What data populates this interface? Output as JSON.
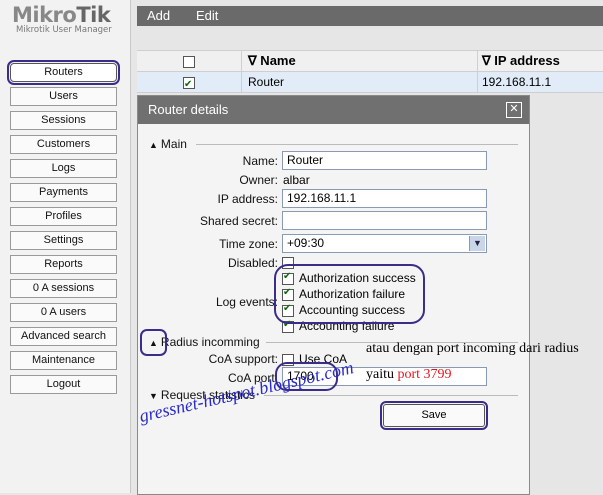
{
  "brand": {
    "logo_main": "Mikro",
    "logo_accent": "Tik",
    "subtitle": "Mikrotik User Manager"
  },
  "sidebar": {
    "items": [
      {
        "label": "Routers",
        "active": true
      },
      {
        "label": "Users"
      },
      {
        "label": "Sessions"
      },
      {
        "label": "Customers"
      },
      {
        "label": "Logs"
      },
      {
        "label": "Payments"
      },
      {
        "label": "Profiles"
      },
      {
        "label": "Settings"
      },
      {
        "label": "Reports"
      },
      {
        "label": "0 A sessions"
      },
      {
        "label": "0 A users"
      },
      {
        "label": "Advanced search"
      },
      {
        "label": "Maintenance"
      },
      {
        "label": "Logout"
      }
    ]
  },
  "toolbar": {
    "add_label": "Add",
    "edit_label": "Edit"
  },
  "table": {
    "headers": {
      "name": "∇ Name",
      "ip": "∇ IP address"
    },
    "rows": [
      {
        "checked": true,
        "name": "Router",
        "ip": "192.168.11.1"
      }
    ]
  },
  "dialog": {
    "title": "Router details",
    "close_symbol": "✕",
    "main_section": "Main",
    "fields": {
      "name_label": "Name:",
      "name_value": "Router",
      "owner_label": "Owner:",
      "owner_value": "albar",
      "ip_label": "IP address:",
      "ip_value": "192.168.11.1",
      "secret_label": "Shared secret:",
      "secret_value": "",
      "timezone_label": "Time zone:",
      "timezone_value": "+09:30",
      "disabled_label": "Disabled:",
      "log_events_label": "Log events:"
    },
    "log_events": [
      {
        "label": "Authorization success",
        "checked": true
      },
      {
        "label": "Authorization failure",
        "checked": true
      },
      {
        "label": "Accounting success",
        "checked": true
      },
      {
        "label": "Accounting failure",
        "checked": true
      }
    ],
    "radius_section": "Radius incomming",
    "coa_support_label": "CoA support:",
    "use_coa_label": "Use CoA",
    "coa_port_label": "CoA port:",
    "coa_port_value": "1700",
    "request_stats_section": "Request statistics",
    "save_label": "Save"
  },
  "annotations": {
    "line1": "atau dengan port incoming dari radius",
    "line2_prefix": "yaitu",
    "line2_port": "port 3799",
    "watermark": "gressnet-hotspot.blogspot.com"
  },
  "colors": {
    "annotation_outline": "#3a2d8a",
    "annotation_red": "#e8141e",
    "watermark": "#2a2ac8",
    "header_bar": "#6a6a6a"
  }
}
